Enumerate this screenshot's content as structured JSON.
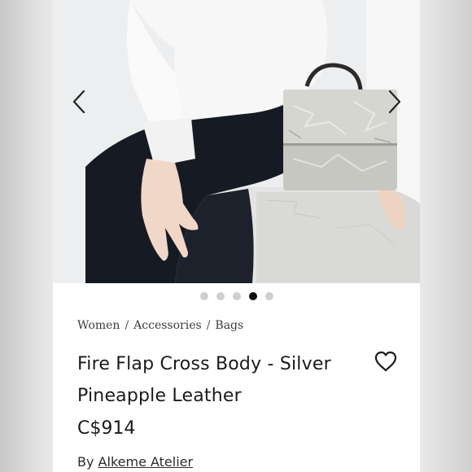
{
  "gallery": {
    "prev_icon": "chevron-left-icon",
    "next_icon": "chevron-right-icon",
    "slide_count": 5,
    "active_slide_index": 3
  },
  "breadcrumb": {
    "items": [
      "Women",
      "Accessories",
      "Bags"
    ],
    "separator": "/"
  },
  "product": {
    "title": "Fire Flap Cross Body - Silver Pineapple Leather",
    "price": "C$914",
    "brand_prefix": "By",
    "brand_name": "Alkeme Atelier",
    "wishlist_icon": "heart-outline-icon"
  },
  "colors": {
    "active_dot": "#111111",
    "inactive_dot": "#cfcfcf",
    "text": "#1a1a1a"
  }
}
